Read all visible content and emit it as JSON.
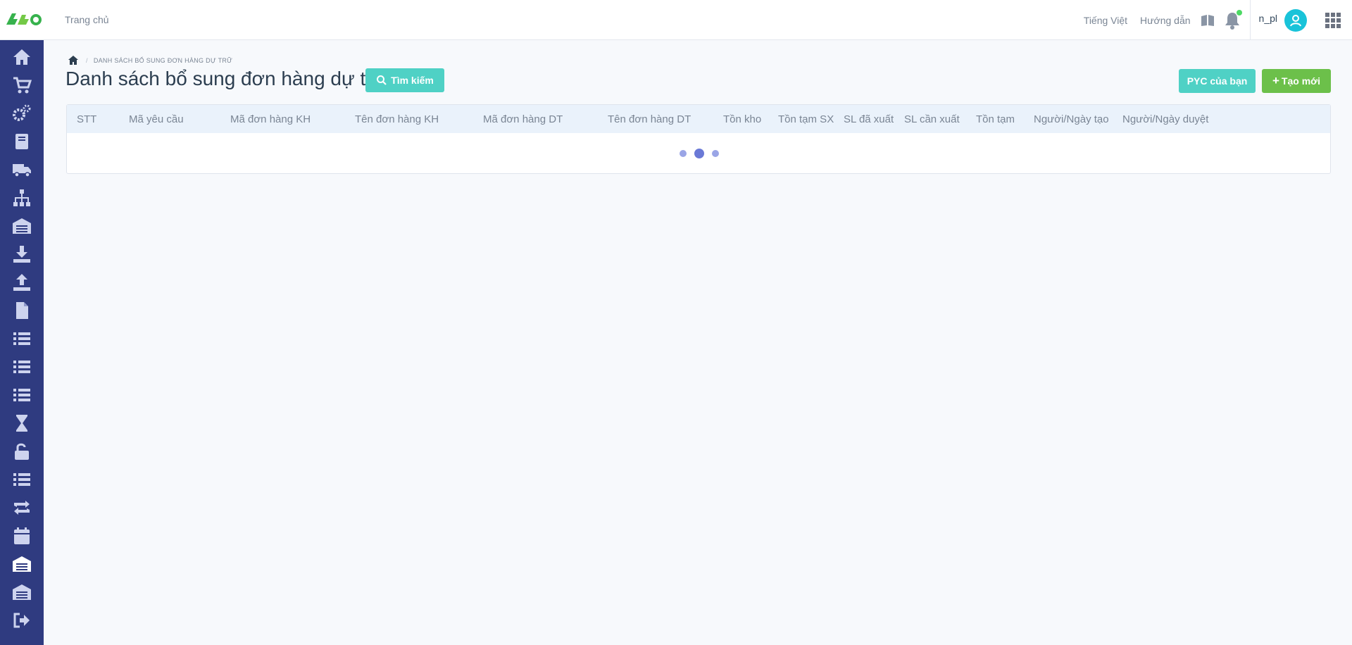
{
  "header": {
    "home_label": "Trang chủ",
    "language": "Tiếng Việt",
    "guide": "Hướng dẫn",
    "username": "n_pl"
  },
  "breadcrumb": {
    "current": "DANH SÁCH BỔ SUNG ĐƠN HÀNG DỰ TRỮ"
  },
  "page": {
    "title": "Danh sách bổ sung đơn hàng dự trữ",
    "search_button": "Tìm kiếm",
    "pyc_button": "PYC của bạn",
    "create_button": "Tạo mới"
  },
  "table": {
    "columns": [
      "STT",
      "Mã yêu cầu",
      "Mã đơn hàng KH",
      "Tên đơn hàng KH",
      "Mã đơn hàng DT",
      "Tên đơn hàng DT",
      "Tồn kho",
      "Tồn tạm SX",
      "SL đã xuất",
      "SL cần xuất",
      "Tồn tạm",
      "Người/Ngày tạo",
      "Người/Ngày duyệt"
    ]
  },
  "sidebar": {
    "items": [
      "home-icon",
      "cart-icon",
      "gears-icon",
      "book-icon",
      "truck-icon",
      "sitemap-icon",
      "warehouse-icon",
      "download-icon",
      "upload-icon",
      "file-icon",
      "list-icon",
      "list-icon",
      "list-icon",
      "hourglass-icon",
      "unlock-icon",
      "list-icon",
      "retweet-icon",
      "calendar-icon",
      "warehouse-active-icon",
      "warehouse-icon",
      "sign-out-icon"
    ]
  },
  "colors": {
    "sidebar": "#2f3b80",
    "accent_teal": "#4fd1c5",
    "accent_green": "#6cc04a"
  }
}
